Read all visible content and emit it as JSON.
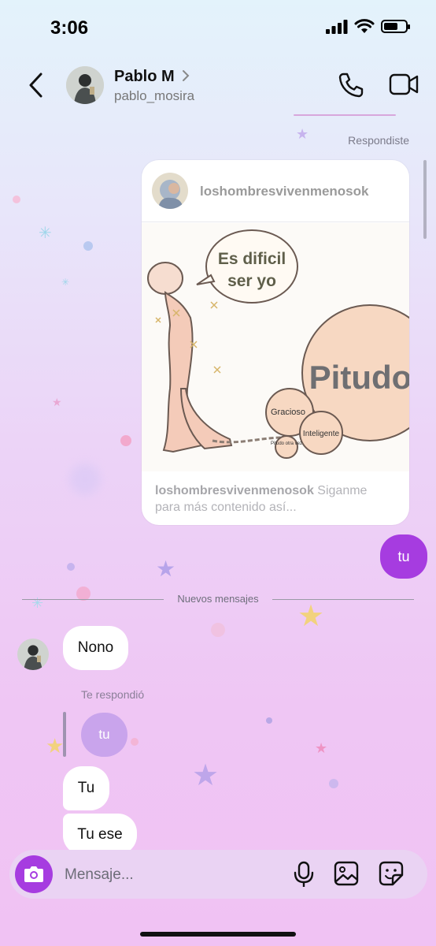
{
  "status_bar": {
    "time": "3:06"
  },
  "header": {
    "name": "Pablo M",
    "handle": "pablo_mosira"
  },
  "thread": {
    "replied_label": "Respondiste",
    "shared_post": {
      "username": "loshombresvivenmenosok",
      "caption_username": "loshombresvivenmenosok",
      "caption_text": " Siganme para más contenido así...",
      "image_texts": {
        "bubble_line1": "Es dificil",
        "bubble_line2": "ser yo",
        "ball_big": "Pitudo",
        "ball_mid": "Gracioso",
        "ball_small": "Inteligente",
        "ball_tiny": "Pitudo otra vez"
      }
    },
    "my_message": "tu",
    "new_messages_label": "Nuevos mensajes",
    "their_message_1": "Nono",
    "replied_to_you_label": "Te respondió",
    "quoted_message": "tu",
    "their_message_2": "Tu",
    "their_message_3": "Tu ese"
  },
  "composer": {
    "placeholder": "Mensaje..."
  },
  "colors": {
    "accent": "#a63ce0",
    "bubble_white": "#ffffff",
    "background_top": "#e3f3fb",
    "background_bottom": "#f0c2f3"
  },
  "icons": [
    "back-chevron-icon",
    "chevron-right-icon",
    "phone-icon",
    "video-camera-icon",
    "camera-icon",
    "microphone-icon",
    "image-icon",
    "sticker-icon",
    "signal-icon",
    "wifi-icon",
    "battery-icon"
  ]
}
